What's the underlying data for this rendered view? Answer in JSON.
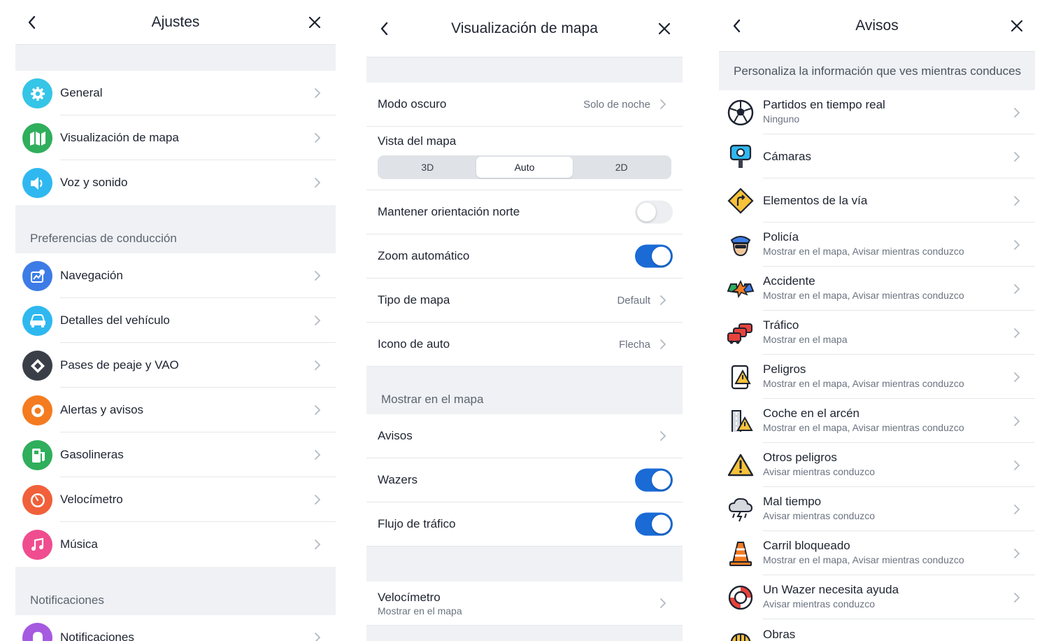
{
  "settings": {
    "title": "Ajustes",
    "items_top": [
      {
        "label": "General",
        "icon": "gear-icon",
        "color": "#35c5e6"
      },
      {
        "label": "Visualización de mapa",
        "icon": "map-icon",
        "color": "#2fae5c"
      },
      {
        "label": "Voz y sonido",
        "icon": "speaker-icon",
        "color": "#2fb8f0"
      }
    ],
    "section_driving": "Preferencias de conducción",
    "items_driving": [
      {
        "label": "Navegación",
        "icon": "navigation-icon",
        "color": "#3d7ce6"
      },
      {
        "label": "Detalles del vehículo",
        "icon": "car-icon",
        "color": "#2fb8f0"
      },
      {
        "label": "Pases de peaje y VAO",
        "icon": "toll-icon",
        "color": "#3a3f47"
      },
      {
        "label": "Alertas y avisos",
        "icon": "alert-pin-icon",
        "color": "#f47b20"
      },
      {
        "label": "Gasolineras",
        "icon": "fuel-icon",
        "color": "#2fae5c"
      },
      {
        "label": "Velocímetro",
        "icon": "speedometer-icon",
        "color": "#f0603a"
      },
      {
        "label": "Música",
        "icon": "music-icon",
        "color": "#ef4d8f"
      }
    ],
    "section_notifications": "Notificaciones",
    "items_notifications": [
      {
        "label": "Notificaciones",
        "icon": "bell-icon",
        "color": "#a55ae0"
      }
    ]
  },
  "map_display": {
    "title": "Visualización de mapa",
    "dark_mode": {
      "label": "Modo oscuro",
      "value": "Solo de noche"
    },
    "map_view": {
      "label": "Vista del mapa",
      "options": [
        "3D",
        "Auto",
        "2D"
      ],
      "selected": "Auto"
    },
    "keep_north": {
      "label": "Mantener orientación norte",
      "on": false
    },
    "auto_zoom": {
      "label": "Zoom automático",
      "on": true
    },
    "map_type": {
      "label": "Tipo de mapa",
      "value": "Default"
    },
    "car_icon": {
      "label": "Icono de auto",
      "value": "Flecha"
    },
    "section_show": "Mostrar en el mapa",
    "reports": {
      "label": "Avisos"
    },
    "wazers": {
      "label": "Wazers",
      "on": true
    },
    "traffic_flow": {
      "label": "Flujo de tráfico",
      "on": true
    },
    "speedometer": {
      "label": "Velocímetro",
      "sub": "Mostrar en el mapa"
    }
  },
  "reports": {
    "title": "Avisos",
    "intro": "Personaliza la información que ves mientras conduces",
    "items": [
      {
        "label": "Partidos en tiempo real",
        "sub": "Ninguno",
        "icon": "soccer-ball-icon"
      },
      {
        "label": "Cámaras",
        "sub": "",
        "icon": "camera-icon"
      },
      {
        "label": "Elementos de la vía",
        "sub": "",
        "icon": "road-sign-icon"
      },
      {
        "label": "Policía",
        "sub": "Mostrar en el mapa, Avisar mientras conduzco",
        "icon": "police-icon"
      },
      {
        "label": "Accidente",
        "sub": "Mostrar en el mapa, Avisar mientras conduzco",
        "icon": "crash-icon"
      },
      {
        "label": "Tráfico",
        "sub": "Mostrar en el mapa",
        "icon": "traffic-icon"
      },
      {
        "label": "Peligros",
        "sub": "Mostrar en el mapa, Avisar mientras conduzco",
        "icon": "hazard-icon"
      },
      {
        "label": "Coche en el arcén",
        "sub": "Mostrar en el mapa, Avisar mientras conduzco",
        "icon": "shoulder-car-icon"
      },
      {
        "label": "Otros peligros",
        "sub": "Avisar mientras conduzco",
        "icon": "warning-icon"
      },
      {
        "label": "Mal tiempo",
        "sub": "Avisar mientras conduzco",
        "icon": "storm-icon"
      },
      {
        "label": "Carril bloqueado",
        "sub": "Mostrar en el mapa, Avisar mientras conduzco",
        "icon": "cone-icon"
      },
      {
        "label": "Un Wazer necesita ayuda",
        "sub": "Avisar mientras conduzco",
        "icon": "lifebuoy-icon"
      },
      {
        "label": "Obras",
        "sub": "",
        "icon": "hard-hat-icon"
      }
    ]
  }
}
